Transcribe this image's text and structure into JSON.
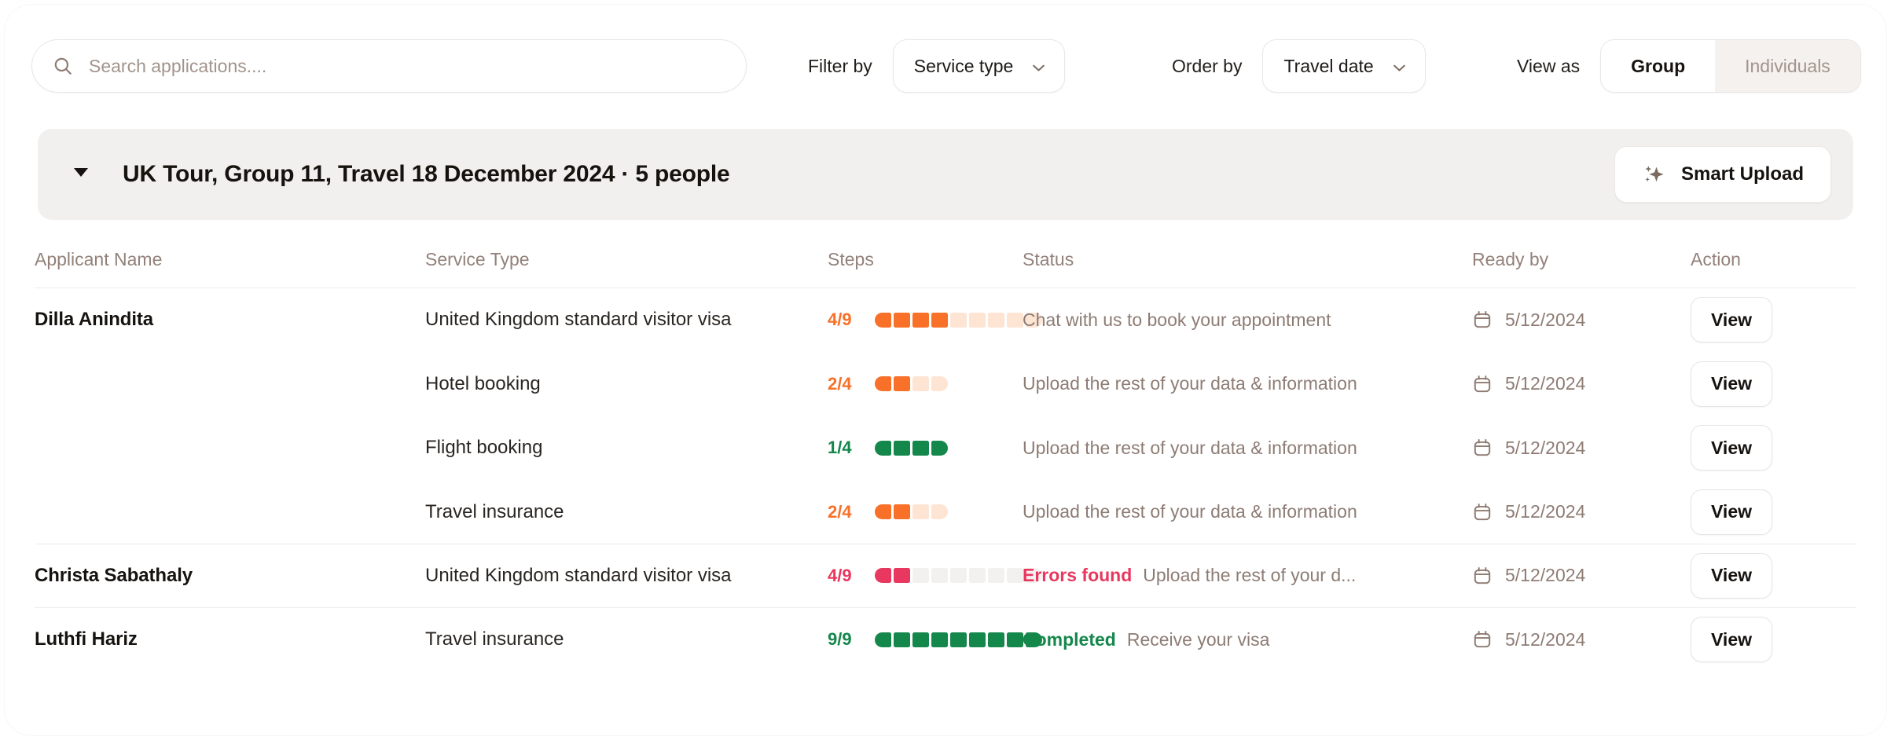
{
  "toolbar": {
    "search": {
      "placeholder": "Search applications....",
      "value": "",
      "icon": "search-icon"
    },
    "filter_by_label": "Filter by",
    "filter_by_value": "Service type",
    "order_by_label": "Order by",
    "order_by_value": "Travel date",
    "view_as_label": "View as",
    "view_as_options": [
      "Group",
      "Individuals"
    ],
    "view_as_selected": "Group"
  },
  "group": {
    "title": "UK Tour, Group 11, Travel 18 December 2024 · 5 people",
    "caret": "chevron-down-icon",
    "smart_upload_label": "Smart Upload",
    "smart_upload_icon": "sparkle-icon"
  },
  "table": {
    "columns": [
      "Applicant Name",
      "Service Type",
      "Steps",
      "Status",
      "Ready by",
      "Action"
    ],
    "action_label": "View",
    "rows": [
      {
        "applicant": "Dilla Anindita",
        "service": "United Kingdom standard visitor visa",
        "steps_text": "4/9",
        "steps_done": 4,
        "steps_total": 9,
        "steps_color": "#f97028",
        "steps_track": "#fde4d3",
        "status_badge": "",
        "status_badge_color": "",
        "status_text": "Chat with us to book your appointment",
        "ready_by": "5/12/2024",
        "action": "View"
      },
      {
        "applicant": "",
        "service": "Hotel booking",
        "steps_text": "2/4",
        "steps_done": 2,
        "steps_total": 4,
        "steps_color": "#f97028",
        "steps_track": "#fde4d3",
        "status_badge": "",
        "status_badge_color": "",
        "status_text": "Upload the rest of your data & information",
        "ready_by": "5/12/2024",
        "action": "View"
      },
      {
        "applicant": "",
        "service": "Flight booking",
        "steps_text": "1/4",
        "steps_done": 4,
        "steps_total": 4,
        "steps_color": "#14874b",
        "steps_track": "#d5ece0",
        "status_badge": "",
        "status_badge_color": "",
        "status_text": "Upload the rest of your data & information",
        "ready_by": "5/12/2024",
        "action": "View"
      },
      {
        "applicant": "",
        "service": "Travel insurance",
        "steps_text": "2/4",
        "steps_done": 2,
        "steps_total": 4,
        "steps_color": "#f97028",
        "steps_track": "#fde4d3",
        "status_badge": "",
        "status_badge_color": "",
        "status_text": "Upload the rest of your data & information",
        "ready_by": "5/12/2024",
        "action": "View"
      },
      {
        "applicant": "Christa Sabathaly",
        "service": "United Kingdom standard visitor visa",
        "steps_text": "4/9",
        "steps_done": 2,
        "steps_total": 9,
        "steps_color": "#e8385f",
        "steps_track": "#f2f1f0",
        "status_badge": "Errors found",
        "status_badge_color": "#e8385f",
        "status_text": "Upload the rest of your d...",
        "ready_by": "5/12/2024",
        "action": "View"
      },
      {
        "applicant": "Luthfi Hariz",
        "service": "Travel insurance",
        "steps_text": "9/9",
        "steps_done": 9,
        "steps_total": 9,
        "steps_color": "#14874b",
        "steps_track": "#d5ece0",
        "status_badge": "Completed",
        "status_badge_color": "#14874b",
        "status_text": "Receive your visa",
        "ready_by": "5/12/2024",
        "action": "View"
      }
    ]
  },
  "colors": {
    "orange": "#f97028",
    "green": "#14874b",
    "red": "#e8385f",
    "muted": "#8d7c74",
    "group_bar": "#f2f0ee"
  }
}
